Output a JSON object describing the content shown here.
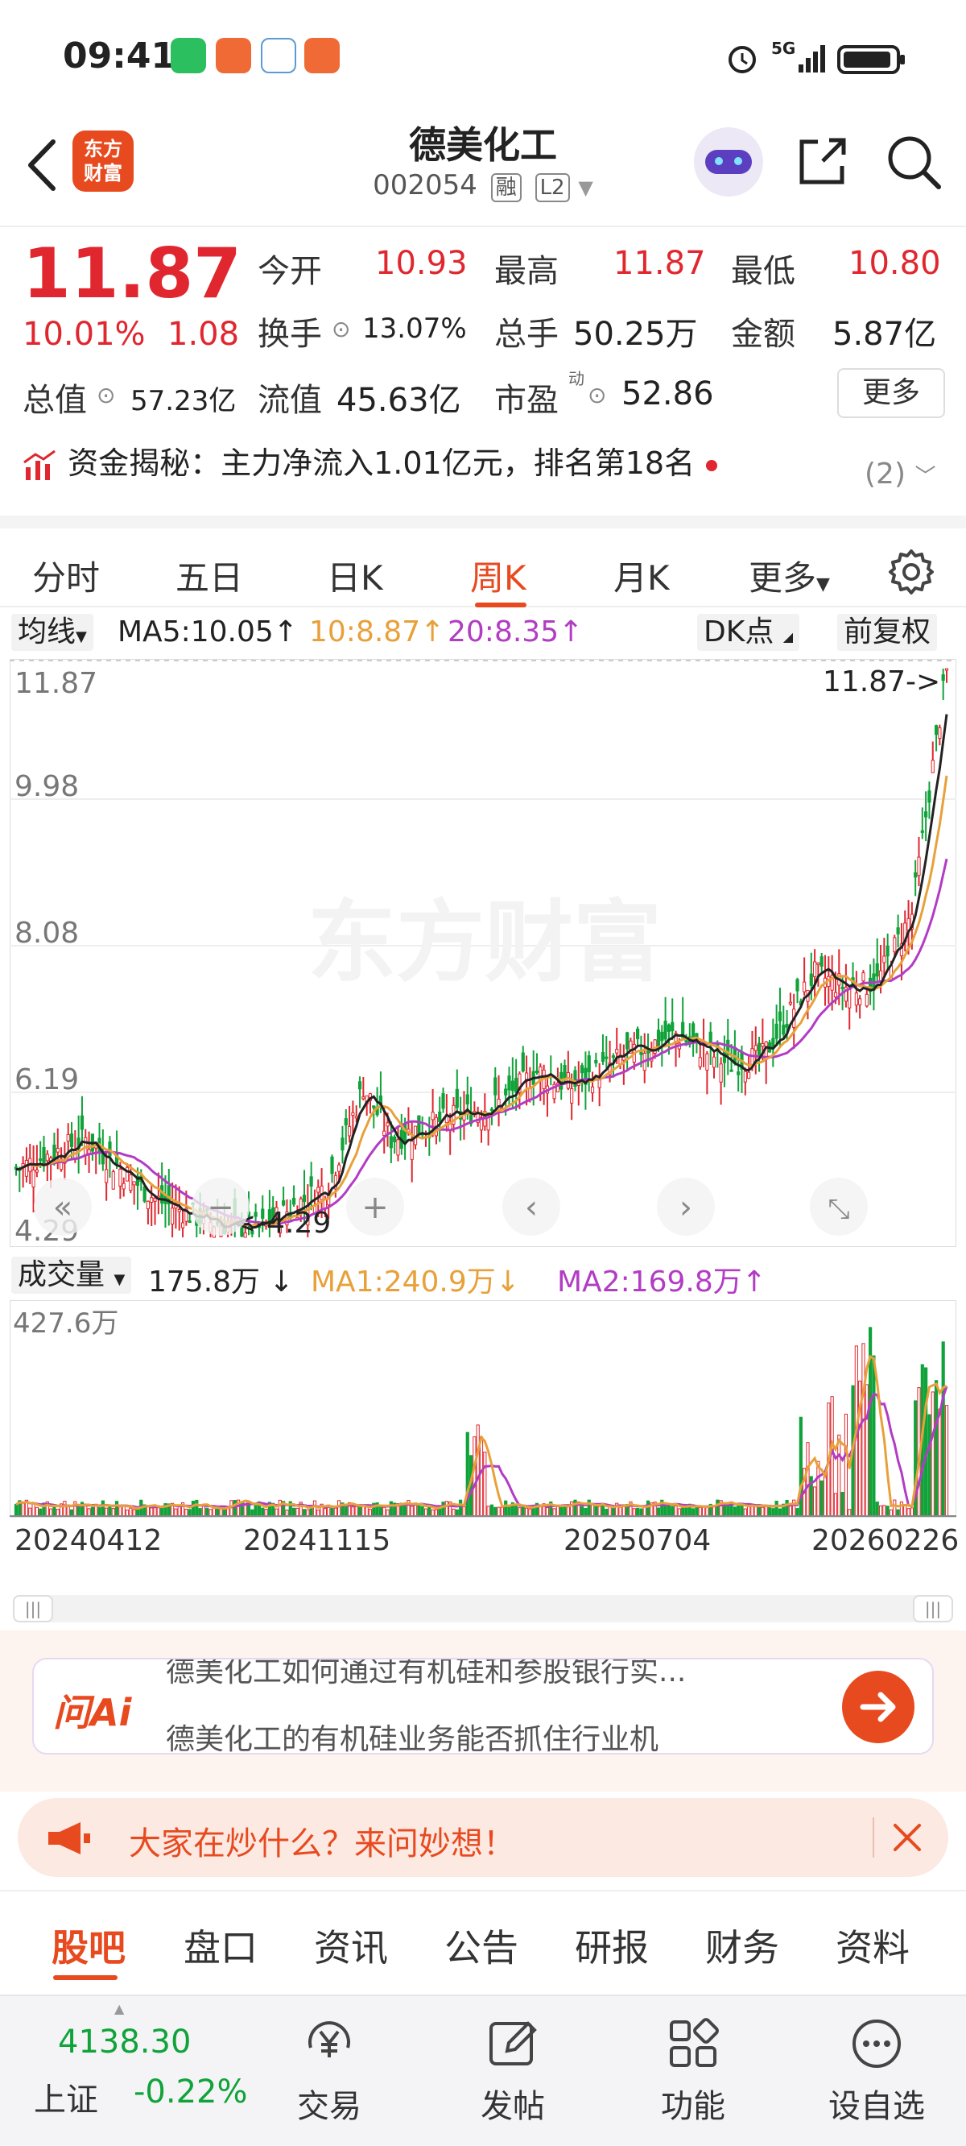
{
  "status_bar": {
    "time": "09:41",
    "network": "5G"
  },
  "header": {
    "logo_text_line1": "东方",
    "logo_text_line2": "财富",
    "title": "德美化工",
    "code": "002054",
    "tag_margin": "融",
    "tag_level": "L2"
  },
  "quote": {
    "price": "11.87",
    "change_pct": "10.01%",
    "change": "1.08",
    "open_label": "今开",
    "open": "10.93",
    "high_label": "最高",
    "high": "11.87",
    "low_label": "最低",
    "low": "10.80",
    "turnover_label": "换手",
    "turnover": "13.07%",
    "volume_label": "总手",
    "volume": "50.25万",
    "amount_label": "金额",
    "amount": "5.87亿",
    "mktcap_label": "总值",
    "mktcap": "57.23亿",
    "float_label": "流值",
    "float": "45.63亿",
    "pe_label": "市盈",
    "pe_sup": "动",
    "pe": "52.86",
    "more_label": "更多",
    "fund_label": "资金揭秘：",
    "fund_text": "主力净流入1.01亿元，排名第18名",
    "fund_count": "(2)"
  },
  "period_tabs": [
    "分时",
    "五日",
    "日K",
    "周K",
    "月K",
    "更多"
  ],
  "active_period": "周K",
  "ma_row": {
    "ma_select": "均线",
    "ma5": "MA5:10.05↑",
    "ma10": "10:8.87↑",
    "ma20": "20:8.35↑",
    "dk_label": "DK点",
    "fq_label": "前复权"
  },
  "chart": {
    "watermark": "东方财富",
    "y_labels": [
      "11.87",
      "9.98",
      "8.08",
      "6.19",
      "4.29"
    ],
    "max_marker": "11.87->",
    "min_marker": "<-4.29"
  },
  "volume_row": {
    "select": "成交量",
    "vol": "175.8万",
    "vol_arrow": "↓",
    "ma1": "MA1:240.9万↓",
    "ma2": "MA2:169.8万↑",
    "max_label": "427.6万"
  },
  "dates": [
    "20240412",
    "20241115",
    "20250704",
    "20260226"
  ],
  "chart_data": {
    "type": "candlestick",
    "title": "",
    "period": "weekly",
    "ylim": [
      4.29,
      11.87
    ],
    "x": [
      "20240412",
      "20241115",
      "20250704",
      "20260226"
    ],
    "latest": {
      "close": 11.87,
      "ma5": 10.05,
      "ma10": 8.87,
      "ma20": 8.35
    },
    "period_high": 11.87,
    "period_low": 4.29,
    "volume_max": "427.6万",
    "volume_latest": "175.8万",
    "volume_ma1": "240.9万",
    "volume_ma2": "169.8万"
  },
  "ai": {
    "logo": "问Ai",
    "q1": "德美化工如何通过有机硅和参股银行实...",
    "q2": "德美化工的有机硅业务能否抓住行业机"
  },
  "banner": {
    "text": "大家在炒什么？来问妙想！"
  },
  "info_tabs": [
    "股吧",
    "盘口",
    "资讯",
    "公告",
    "研报",
    "财务",
    "资料"
  ],
  "bottom_nav": {
    "index_value": "4138.30",
    "index_name": "上证",
    "index_change": "-0.22%",
    "trade": "交易",
    "post": "发帖",
    "func": "功能",
    "watch": "设自选"
  },
  "colors": {
    "up": "#e0262e",
    "down": "#10a33a",
    "accent": "#e84a1f",
    "ma10": "#e8a13a",
    "ma20": "#b23cc4"
  }
}
